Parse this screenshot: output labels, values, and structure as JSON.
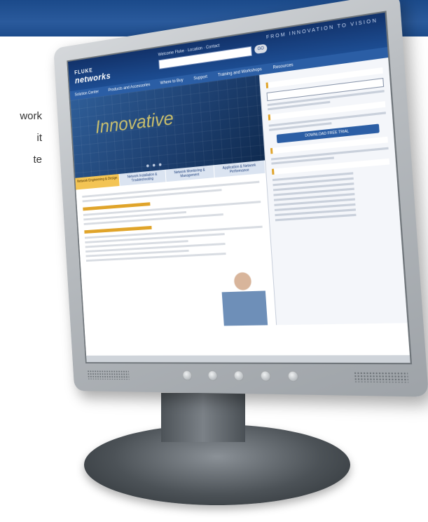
{
  "side_text": [
    "work",
    "it",
    "te"
  ],
  "site": {
    "logo_small": "FLUKE",
    "logo": "networks",
    "tagline": "FROM INNOVATION TO VISION",
    "util_link": "Welcome Fluke · Location · Contact",
    "go_label": "GO",
    "nav": [
      "Solution Center",
      "Products and Accessories",
      "Where to Buy",
      "Support",
      "Training and Workshops",
      "Resources"
    ],
    "hero_title": "Innovative",
    "tabs": [
      "Network Engineering & Design",
      "Network Installation & Troubleshooting",
      "Network Monitoring & Management",
      "Application & Network Performance"
    ],
    "cta_label": "DOWNLOAD FREE TRIAL"
  }
}
